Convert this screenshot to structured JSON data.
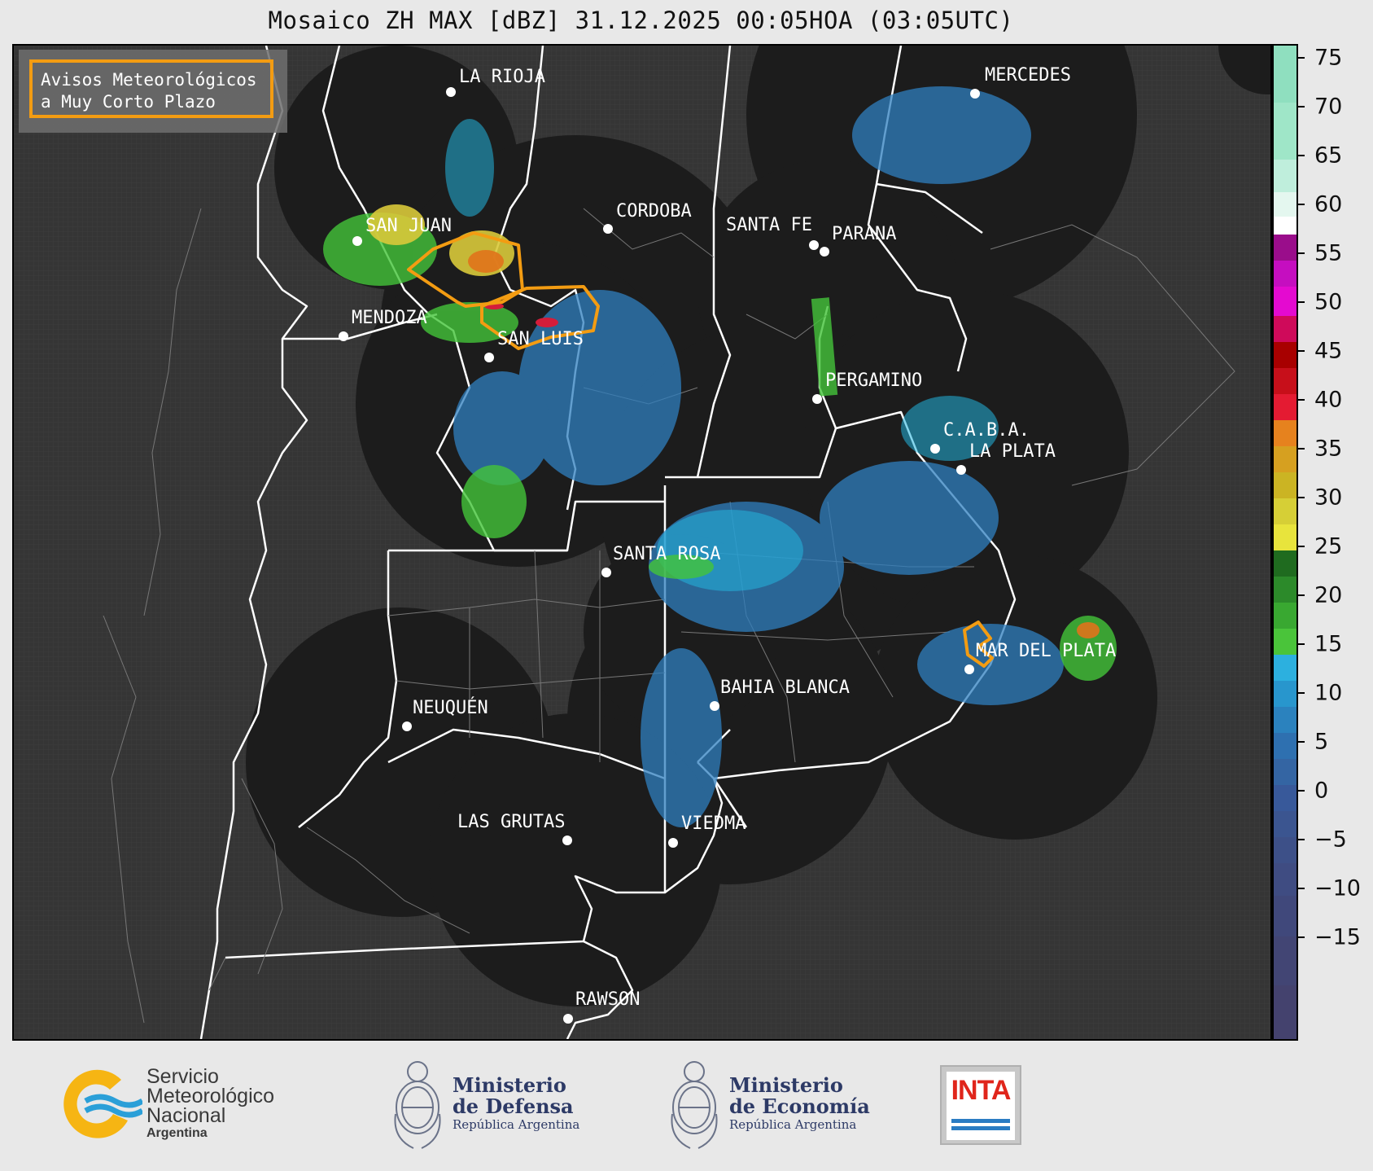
{
  "title": "Mosaico ZH MAX [dBZ] 31.12.2025 00:05HOA (03:05UTC)",
  "legend": {
    "line1": "Avisos Meteorológicos",
    "line2": "a Muy Corto Plazo",
    "outline_color": "#f39c12"
  },
  "cities": [
    {
      "name": "LA RIOJA"
    },
    {
      "name": "SAN JUAN"
    },
    {
      "name": "CORDOBA"
    },
    {
      "name": "SANTA FE"
    },
    {
      "name": "PARANA"
    },
    {
      "name": "MERCEDES"
    },
    {
      "name": "MENDOZA"
    },
    {
      "name": "SAN LUIS"
    },
    {
      "name": "PERGAMINO"
    },
    {
      "name": "C.A.B.A."
    },
    {
      "name": "LA PLATA"
    },
    {
      "name": "SANTA ROSA"
    },
    {
      "name": "MAR DEL PLATA"
    },
    {
      "name": "BAHIA BLANCA"
    },
    {
      "name": "NEUQUÉN"
    },
    {
      "name": "LAS GRUTAS"
    },
    {
      "name": "VIEDMA"
    },
    {
      "name": "RAWSON"
    }
  ],
  "colorbar": {
    "unit": "dBZ",
    "ticks": [
      "75",
      "70",
      "65",
      "60",
      "55",
      "50",
      "45",
      "40",
      "35",
      "30",
      "25",
      "20",
      "15",
      "10",
      "5",
      "0",
      "−5",
      "−10",
      "−15"
    ]
  },
  "footer": {
    "smn": {
      "line1": "Servicio",
      "line2": "Meteorológico",
      "line3": "Nacional",
      "line4": "Argentina"
    },
    "defensa": {
      "line1": "Ministerio",
      "line2": "de Defensa",
      "line3": "República Argentina"
    },
    "economia": {
      "line1": "Ministerio",
      "line2": "de Economía",
      "line3": "República Argentina"
    },
    "inta": {
      "text": "INTA"
    }
  },
  "colors": {
    "map_bg": "#353535",
    "radar_disk": "#1c1c1c",
    "warning": "#f39c12"
  }
}
